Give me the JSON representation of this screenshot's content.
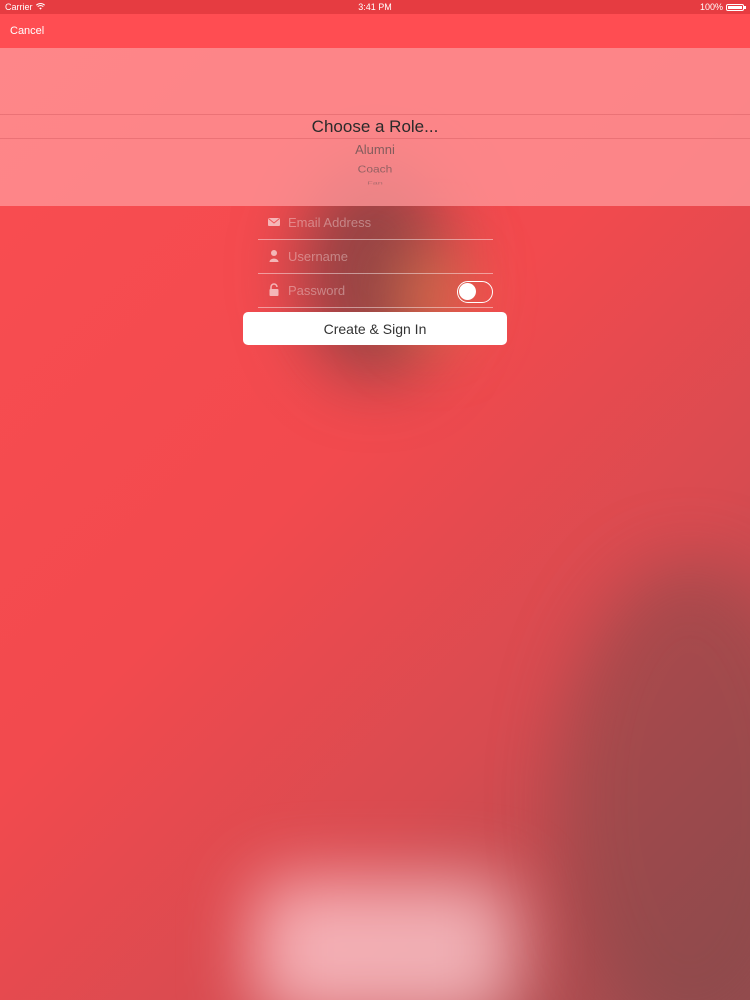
{
  "status_bar": {
    "carrier": "Carrier",
    "time": "3:41 PM",
    "battery": "100%"
  },
  "nav": {
    "cancel_label": "Cancel"
  },
  "picker": {
    "selected": "Choose a Role...",
    "options": [
      "Alumni",
      "Coach",
      "Fan"
    ]
  },
  "form": {
    "email": {
      "placeholder": "Email Address",
      "icon": "envelope-icon"
    },
    "username": {
      "placeholder": "Username",
      "icon": "person-icon"
    },
    "password": {
      "placeholder": "Password",
      "icon": "lock-icon",
      "toggle_on": false
    },
    "submit_label": "Create & Sign In"
  },
  "colors": {
    "primary": "#ff4d52",
    "status": "#e63c41",
    "picker": "#ff9698"
  }
}
